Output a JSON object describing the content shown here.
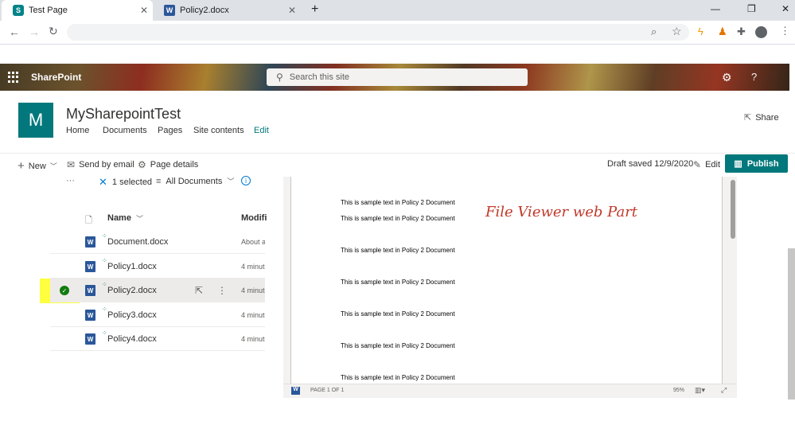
{
  "browser": {
    "tabs": [
      {
        "title": "Test Page",
        "active": true,
        "icon": "sharepoint-icon"
      },
      {
        "title": "Policy2.docx",
        "active": false,
        "icon": "word-icon"
      }
    ],
    "new_tab_glyph": "+"
  },
  "suite": {
    "brand": "SharePoint",
    "search_placeholder": "Search this site",
    "help_glyph": "?"
  },
  "site": {
    "logo_letter": "M",
    "title": "MySharepointTest",
    "nav": [
      "Home",
      "Documents",
      "Pages",
      "Site contents",
      "Edit"
    ],
    "share_label": "Share"
  },
  "commandbar": {
    "new_label": "New",
    "send_label": "Send by email",
    "details_label": "Page details",
    "draft_status": "Draft saved 12/9/2020",
    "edit_label": "Edit",
    "publish_label": "Publish"
  },
  "library": {
    "selected_count": "1 selected",
    "view_name": "All Documents",
    "more_glyph": "···",
    "columns": {
      "name": "Name",
      "modified": "Modifi"
    },
    "files": [
      {
        "name": "Document.docx",
        "modified": "About a"
      },
      {
        "name": "Policy1.docx",
        "modified": "4 minute"
      },
      {
        "name": "Policy2.docx",
        "modified": "4 minute",
        "selected": true
      },
      {
        "name": "Policy3.docx",
        "modified": "4 minute"
      },
      {
        "name": "Policy4.docx",
        "modified": "4 minute"
      }
    ]
  },
  "viewer": {
    "annotation": "File Viewer web Part",
    "lines": [
      "This is sample text in Policy 2 Document",
      "This is sample text in Policy 2 Document",
      "This is sample text in Policy 2 Document",
      "This is sample text in Policy 2 Document",
      "This is sample text in Policy 2 Document",
      "This is sample text in Policy 2 Document",
      "This is sample text in Policy 2 Document"
    ],
    "page_label": "PAGE 1 OF 1",
    "zoom": "95%"
  },
  "colors": {
    "accent": "#03787c",
    "highlight": "#ffff40",
    "annotation": "#c0392b",
    "word": "#2b579a"
  }
}
